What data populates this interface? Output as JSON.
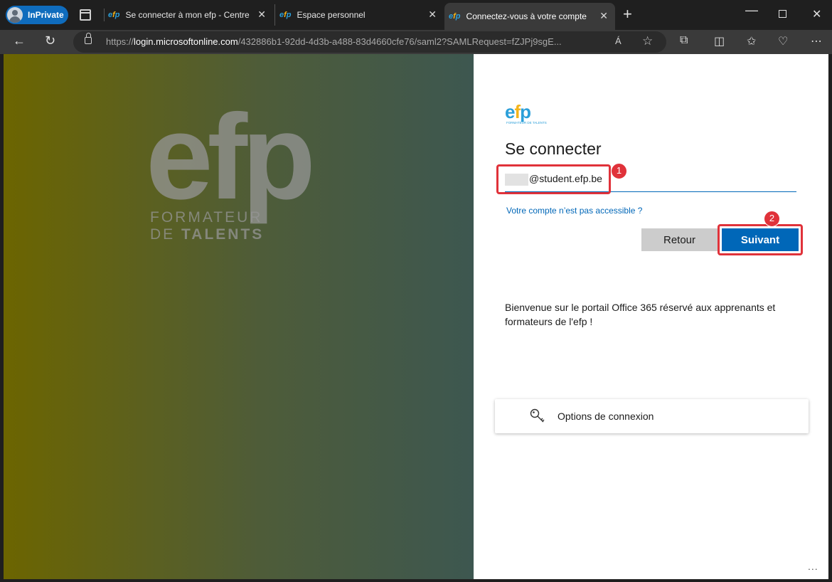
{
  "browser": {
    "inprivate_label": "InPrivate",
    "tabs": [
      {
        "title": "Se connecter à mon efp - Centre d'aide",
        "favicon": "efp-favicon"
      },
      {
        "title": "Espace personnel",
        "favicon": "efp-favicon"
      },
      {
        "title": "Connectez-vous à votre compte",
        "favicon": "efp-favicon",
        "active": true
      }
    ],
    "favicon_text": {
      "e": "e",
      "f": "f",
      "p": "p"
    },
    "url_prefix": "https://",
    "url_host": "login.microsoftonline.com",
    "url_rest": "/432886b1-92dd-4d3b-a488-83d4660cfe76/saml2?SAMLRequest=fZJPj9sgE...",
    "readaloud_label": "Á"
  },
  "background_logo": {
    "wordmark": "efp",
    "line1": "FORMATEUR",
    "line2_prefix": "DE ",
    "line2_bold": "TALENTS"
  },
  "signin": {
    "logo": {
      "e": "e",
      "f": "f",
      "p": "p",
      "tagline": "FORMATEUR DE TALENTS"
    },
    "heading": "Se connecter",
    "email_value": "@student.efp.be",
    "inaccessible_link": "Votre compte n’est pas accessible ?",
    "back_button": "Retour",
    "next_button": "Suivant",
    "welcome_text": "Bienvenue sur le portail Office 365 réservé aux apprenants et formateurs de l'efp !",
    "options_label": "Options de connexion",
    "more_label": "..."
  },
  "annotations": {
    "badge1": "1",
    "badge2": "2",
    "highlight_color": "#e0323a"
  },
  "colors": {
    "accent": "#0067b8",
    "efp_blue": "#2b9fd9",
    "efp_yellow": "#f4b41a",
    "edge_inprivate": "#0f6cbd"
  }
}
